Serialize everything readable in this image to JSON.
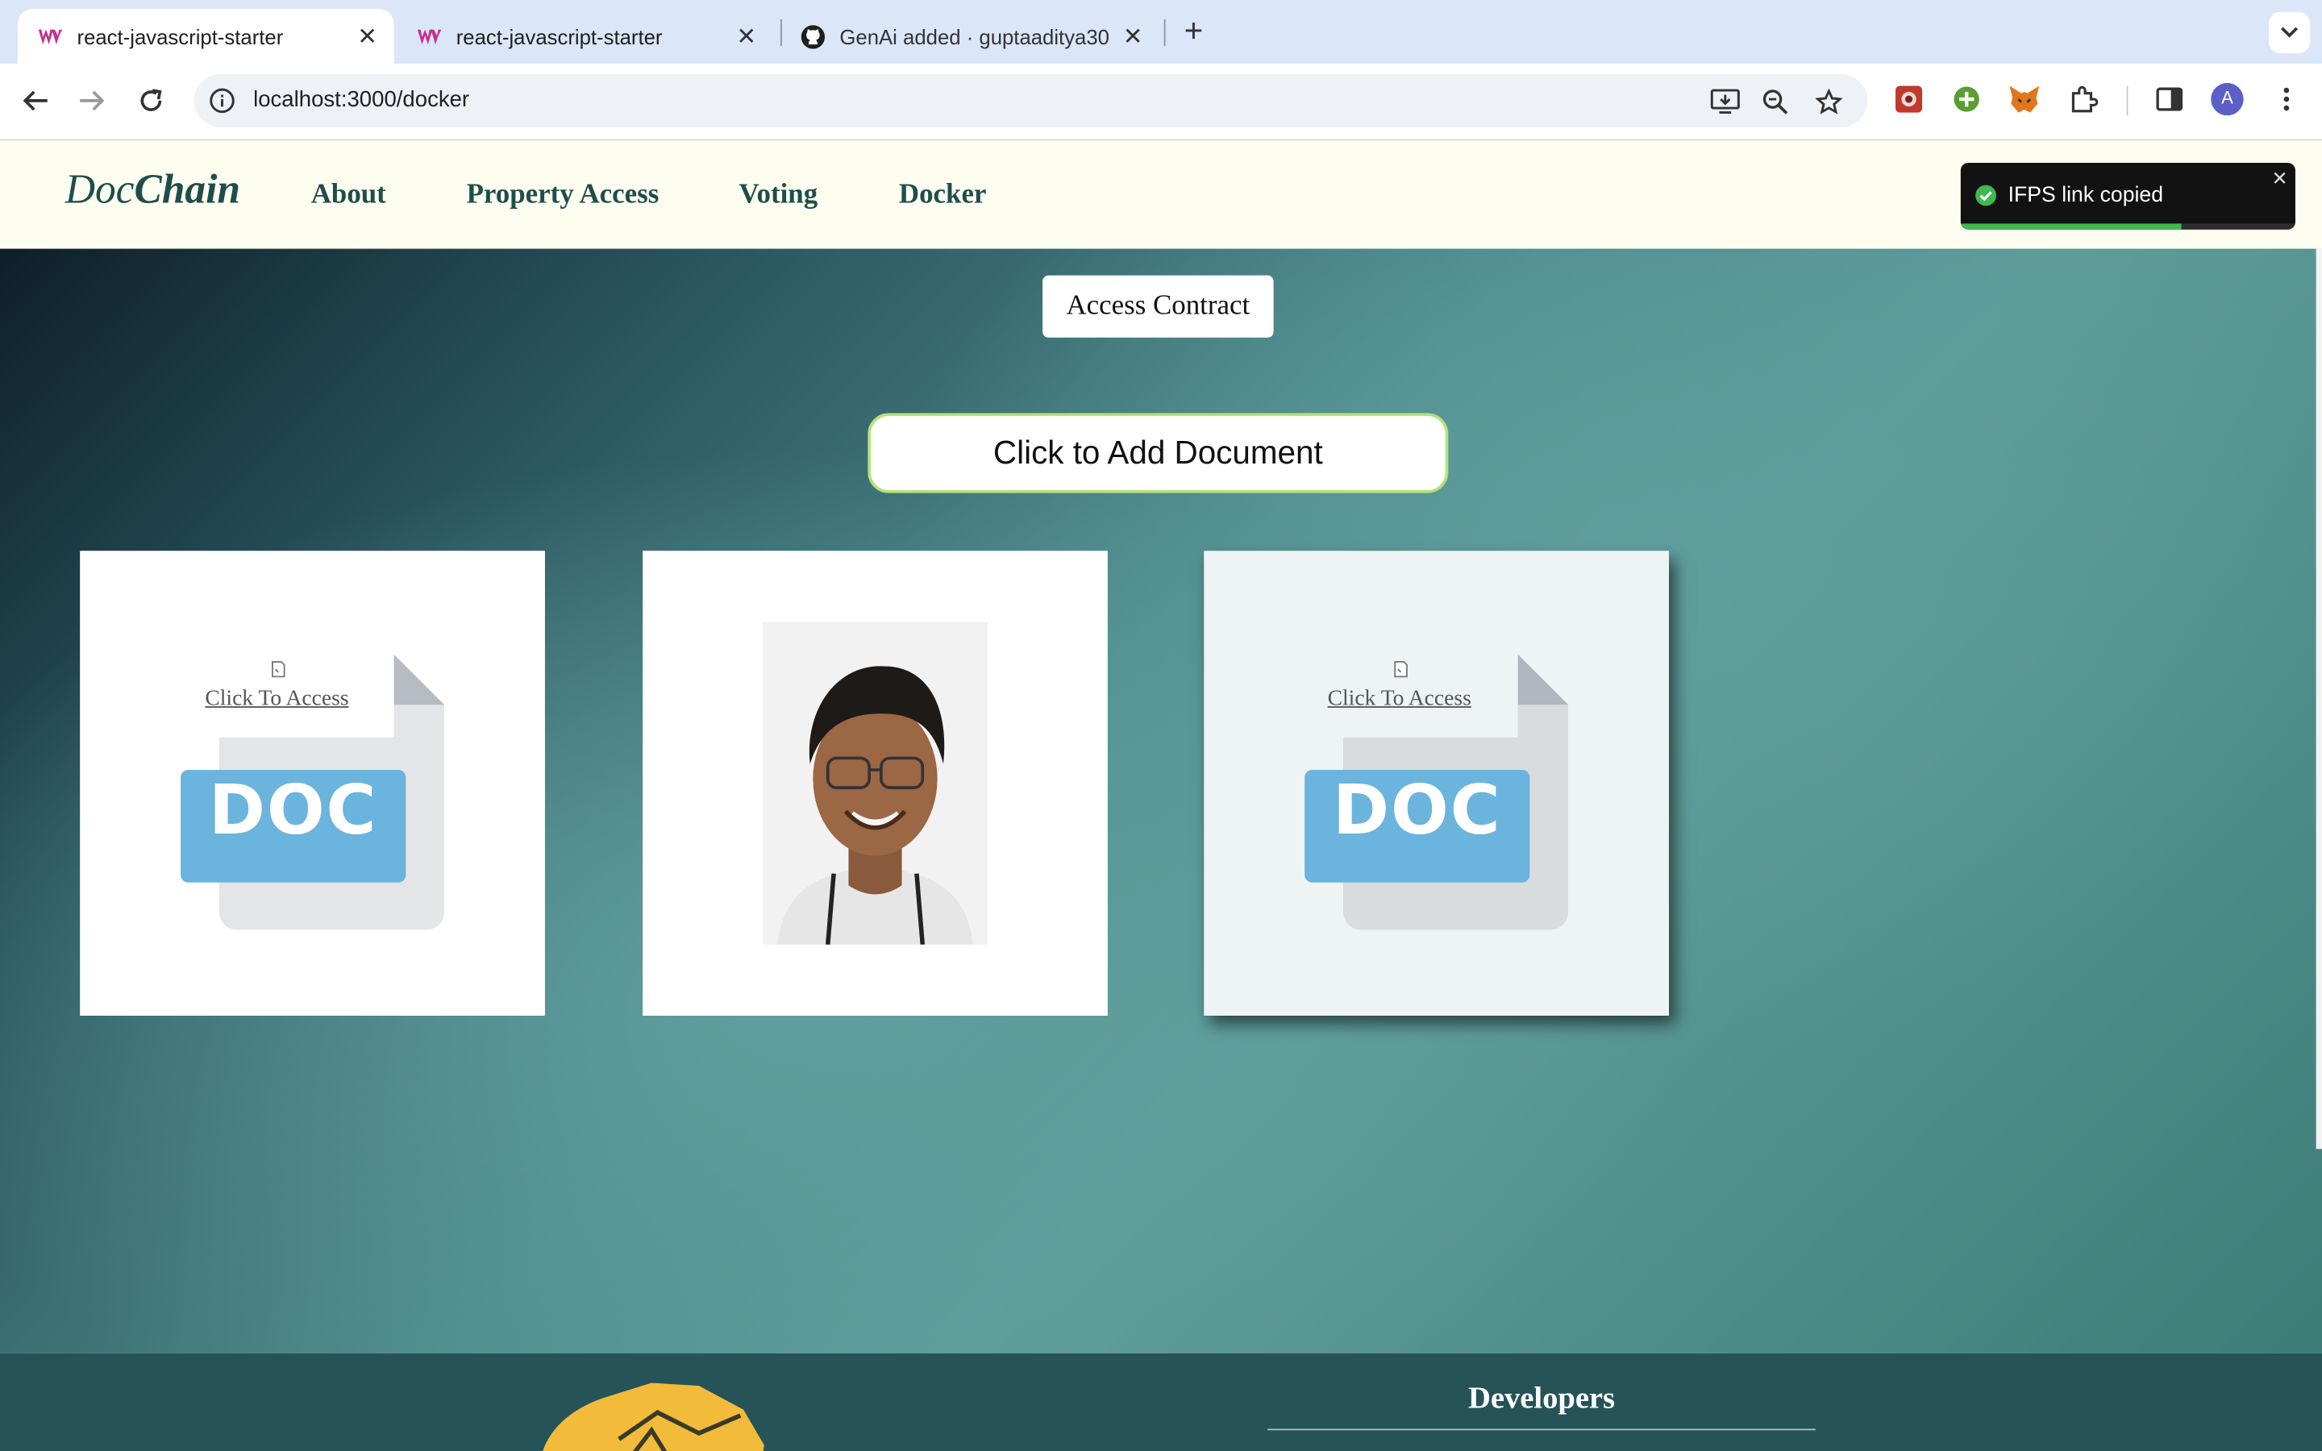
{
  "browser": {
    "tabs": [
      {
        "title": "react-javascript-starter",
        "active": true,
        "icon": "webpack-icon"
      },
      {
        "title": "react-javascript-starter",
        "active": false,
        "icon": "webpack-icon"
      },
      {
        "title": "GenAi added · guptaaditya30",
        "active": false,
        "icon": "github-icon"
      }
    ],
    "url": "localhost:3000/docker",
    "profile_initial": "A"
  },
  "app": {
    "brand_part1": "Doc",
    "brand_part2": "Chain",
    "nav": [
      "About",
      "Property Access",
      "Voting",
      "Docker"
    ]
  },
  "main": {
    "access_contract_label": "Access Contract",
    "add_document_label": "Click to Add Document",
    "cards": [
      {
        "type": "doc",
        "link": "Click To Access",
        "badge": "DOC"
      },
      {
        "type": "photo"
      },
      {
        "type": "doc",
        "link": "Click To Access",
        "badge": "DOC",
        "hovered": true
      }
    ]
  },
  "footer": {
    "developers_title": "Developers"
  },
  "toast": {
    "message": "IFPS link copied",
    "progress": 0.66
  },
  "colors": {
    "nav_bg": "#fefef0",
    "brand": "#1f4d4b",
    "doc_blue": "#6ab4dd",
    "toast_ok": "#3fb950"
  }
}
